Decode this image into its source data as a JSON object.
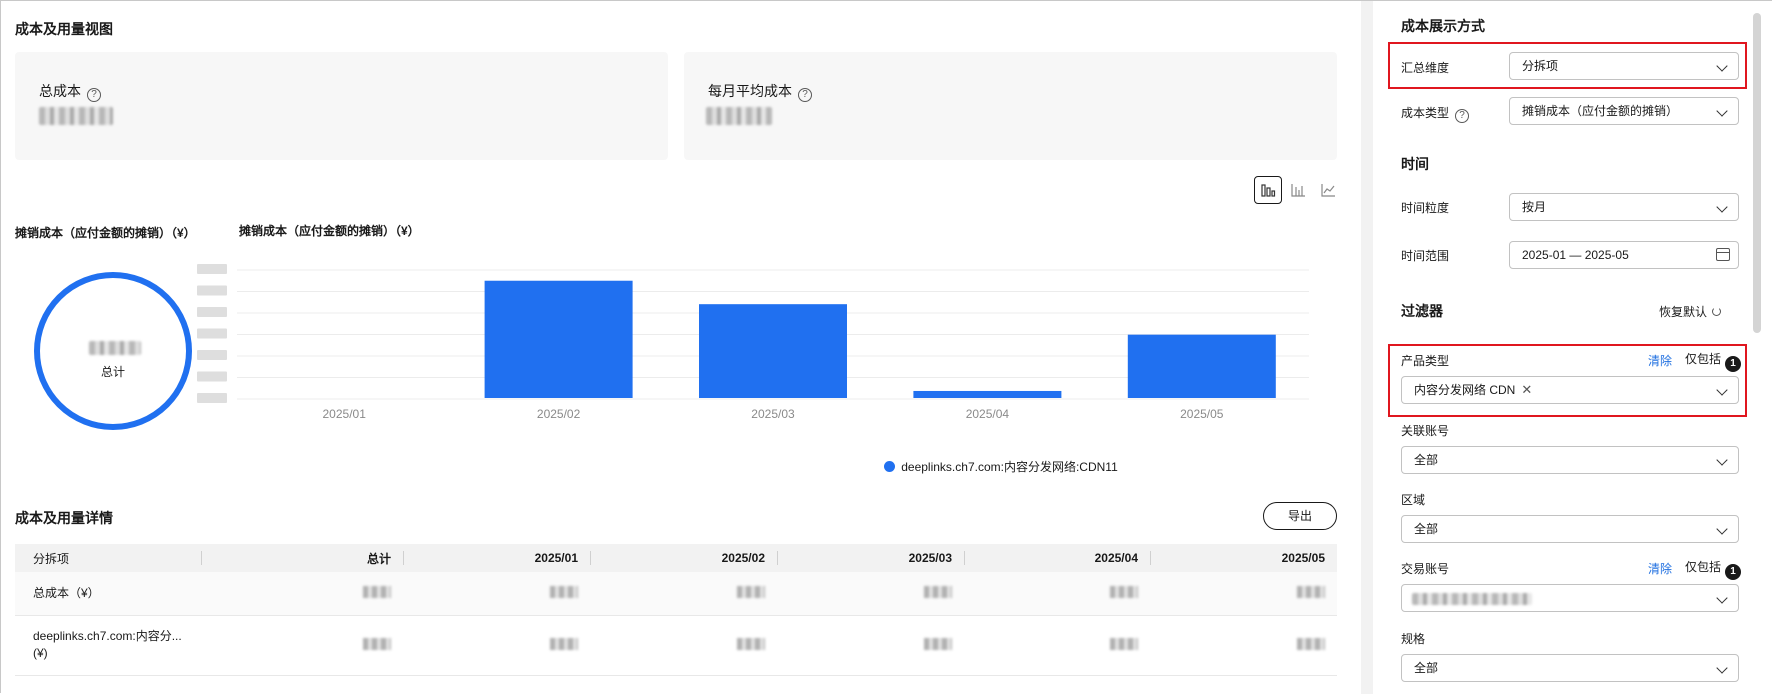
{
  "overview": {
    "title": "成本及用量视图",
    "total_cost_label": "总成本",
    "monthly_avg_label": "每月平均成本"
  },
  "chart_section": {
    "donut_title": "摊销成本（应付金额的摊销）（¥）",
    "bar_title": "摊销成本（应付金额的摊销）（¥）",
    "donut_total_label": "总计",
    "view_icons": [
      "grouped-bar-icon",
      "stacked-bar-icon",
      "line-chart-icon"
    ]
  },
  "chart_data": {
    "type": "bar",
    "title": "摊销成本（应付金额的摊销）（¥）",
    "categories": [
      "2025/01",
      "2025/02",
      "2025/03",
      "2025/04",
      "2025/05"
    ],
    "series": [
      {
        "name": "deeplinks.ch7.com:内容分发网络:CDN11",
        "values": [
          0,
          100,
          80,
          6,
          54
        ]
      }
    ],
    "ylim": [
      0,
      110
    ],
    "grid": true,
    "legend": "bottom",
    "bar_color": "#2070f0",
    "note": "y-axis values are obscured in the original; relative heights only"
  },
  "detail": {
    "title": "成本及用量详情",
    "export_label": "导出",
    "columns": [
      "分拆项",
      "总计",
      "2025/01",
      "2025/02",
      "2025/03",
      "2025/04",
      "2025/05"
    ],
    "rows": [
      {
        "label": "总成本（¥）"
      },
      {
        "label": "deeplinks.ch7.com:内容分...",
        "label2": "(¥)"
      }
    ]
  },
  "panel": {
    "display_title": "成本展示方式",
    "summary_dim_label": "汇总维度",
    "summary_dim_value": "分拆项",
    "cost_type_label": "成本类型",
    "cost_type_value": "摊销成本（应付金额的摊销）",
    "time_title": "时间",
    "granularity_label": "时间粒度",
    "granularity_value": "按月",
    "range_label": "时间范围",
    "range_value": "2025-01 — 2025-05",
    "filter_title": "过滤器",
    "reset_label": "恢复默认",
    "product_type_label": "产品类型",
    "clear_label": "清除",
    "include_only_label": "仅包括",
    "product_badge": "1",
    "product_tag": "内容分发网络 CDN",
    "linked_account_label": "关联账号",
    "linked_account_value": "全部",
    "region_label": "区域",
    "region_value": "全部",
    "trade_account_label": "交易账号",
    "trade_badge": "1",
    "spec_label": "规格",
    "spec_value": "全部"
  },
  "colors": {
    "accent": "#2070f0",
    "link": "#1f6fe0",
    "highlight": "#e0161f"
  }
}
